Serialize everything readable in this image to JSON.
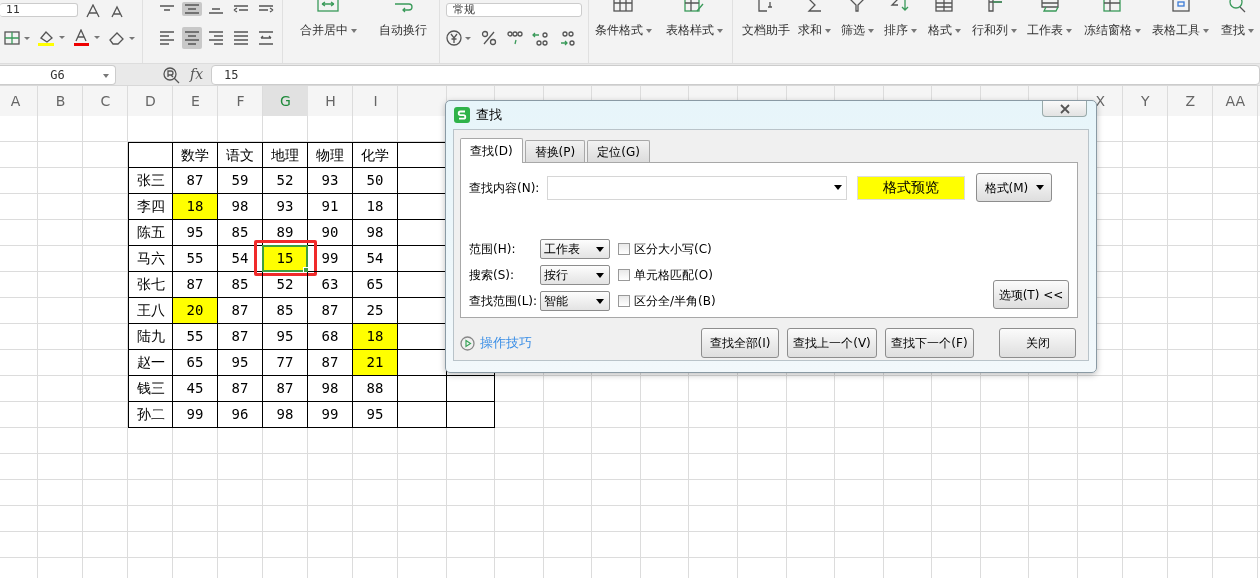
{
  "ribbon": {
    "font_size": "11",
    "number_format": "常规",
    "vertical_align": [
      {
        "selected": false
      },
      {
        "selected": true
      },
      {
        "selected": false
      },
      {
        "selected": false
      },
      {
        "selected": false
      }
    ],
    "horizontal_align": [
      {
        "selected": false
      },
      {
        "selected": true
      },
      {
        "selected": false
      },
      {
        "selected": false
      },
      {
        "selected": false
      }
    ],
    "merge": "合并居中",
    "wrap": "自动换行",
    "buttons": [
      {
        "label": "条件格式"
      },
      {
        "label": "表格样式"
      },
      {
        "label": "文档助手"
      },
      {
        "label": "求和"
      },
      {
        "label": "筛选"
      },
      {
        "label": "排序"
      },
      {
        "label": "格式"
      },
      {
        "label": "行和列"
      },
      {
        "label": "工作表"
      },
      {
        "label": "冻结窗格"
      },
      {
        "label": "表格工具"
      },
      {
        "label": "查找"
      }
    ]
  },
  "formula_bar": {
    "cell_ref": "G6",
    "fx": "fx",
    "value": "15"
  },
  "sheet": {
    "columns_left": [
      {
        "label": "A",
        "selected": false
      },
      {
        "label": "B",
        "selected": false
      },
      {
        "label": "C",
        "selected": false
      },
      {
        "label": "D",
        "selected": false
      },
      {
        "label": "E",
        "selected": false
      },
      {
        "label": "F",
        "selected": false
      },
      {
        "label": "G",
        "selected": true
      },
      {
        "label": "H",
        "selected": false
      },
      {
        "label": "I",
        "selected": false
      }
    ],
    "columns_right": [
      {
        "label": "X",
        "selected": false
      },
      {
        "label": "Y",
        "selected": false
      },
      {
        "label": "Z",
        "selected": false
      },
      {
        "label": "AA",
        "selected": false
      }
    ],
    "annotated_selection": true,
    "table_header": [
      "数学",
      "语文",
      "地理",
      "物理",
      "化学"
    ],
    "rows": [
      {
        "name": "张三",
        "cells": [
          {
            "text": "87",
            "highlighted": false,
            "selected": false
          },
          {
            "text": "59",
            "highlighted": false,
            "selected": false
          },
          {
            "text": "52",
            "highlighted": false,
            "selected": false
          },
          {
            "text": "93",
            "highlighted": false,
            "selected": false
          },
          {
            "text": "50",
            "highlighted": false,
            "selected": false
          }
        ]
      },
      {
        "name": "李四",
        "cells": [
          {
            "text": "18",
            "highlighted": true,
            "selected": false
          },
          {
            "text": "98",
            "highlighted": false,
            "selected": false
          },
          {
            "text": "93",
            "highlighted": false,
            "selected": false
          },
          {
            "text": "91",
            "highlighted": false,
            "selected": false
          },
          {
            "text": "18",
            "highlighted": false,
            "selected": false
          }
        ]
      },
      {
        "name": "陈五",
        "cells": [
          {
            "text": "95",
            "highlighted": false,
            "selected": false
          },
          {
            "text": "85",
            "highlighted": false,
            "selected": false
          },
          {
            "text": "89",
            "highlighted": false,
            "selected": false
          },
          {
            "text": "90",
            "highlighted": false,
            "selected": false
          },
          {
            "text": "98",
            "highlighted": false,
            "selected": false
          }
        ]
      },
      {
        "name": "马六",
        "cells": [
          {
            "text": "55",
            "highlighted": false,
            "selected": false
          },
          {
            "text": "54",
            "highlighted": false,
            "selected": false
          },
          {
            "text": "15",
            "highlighted": true,
            "selected": true
          },
          {
            "text": "99",
            "highlighted": false,
            "selected": false
          },
          {
            "text": "54",
            "highlighted": false,
            "selected": false
          }
        ]
      },
      {
        "name": "张七",
        "cells": [
          {
            "text": "87",
            "highlighted": false,
            "selected": false
          },
          {
            "text": "85",
            "highlighted": false,
            "selected": false
          },
          {
            "text": "52",
            "highlighted": false,
            "selected": false
          },
          {
            "text": "63",
            "highlighted": false,
            "selected": false
          },
          {
            "text": "65",
            "highlighted": false,
            "selected": false
          }
        ]
      },
      {
        "name": "王八",
        "cells": [
          {
            "text": "20",
            "highlighted": true,
            "selected": false
          },
          {
            "text": "87",
            "highlighted": false,
            "selected": false
          },
          {
            "text": "85",
            "highlighted": false,
            "selected": false
          },
          {
            "text": "87",
            "highlighted": false,
            "selected": false
          },
          {
            "text": "25",
            "highlighted": false,
            "selected": false
          }
        ]
      },
      {
        "name": "陆九",
        "cells": [
          {
            "text": "55",
            "highlighted": false,
            "selected": false
          },
          {
            "text": "87",
            "highlighted": false,
            "selected": false
          },
          {
            "text": "95",
            "highlighted": false,
            "selected": false
          },
          {
            "text": "68",
            "highlighted": false,
            "selected": false
          },
          {
            "text": "18",
            "highlighted": true,
            "selected": false
          }
        ]
      },
      {
        "name": "赵一",
        "cells": [
          {
            "text": "65",
            "highlighted": false,
            "selected": false
          },
          {
            "text": "95",
            "highlighted": false,
            "selected": false
          },
          {
            "text": "77",
            "highlighted": false,
            "selected": false
          },
          {
            "text": "87",
            "highlighted": false,
            "selected": false
          },
          {
            "text": "21",
            "highlighted": true,
            "selected": false
          }
        ]
      },
      {
        "name": "钱三",
        "cells": [
          {
            "text": "45",
            "highlighted": false,
            "selected": false
          },
          {
            "text": "87",
            "highlighted": false,
            "selected": false
          },
          {
            "text": "87",
            "highlighted": false,
            "selected": false
          },
          {
            "text": "98",
            "highlighted": false,
            "selected": false
          },
          {
            "text": "88",
            "highlighted": false,
            "selected": false
          }
        ]
      },
      {
        "name": "孙二",
        "cells": [
          {
            "text": "99",
            "highlighted": false,
            "selected": false
          },
          {
            "text": "96",
            "highlighted": false,
            "selected": false
          },
          {
            "text": "98",
            "highlighted": false,
            "selected": false
          },
          {
            "text": "99",
            "highlighted": false,
            "selected": false
          },
          {
            "text": "95",
            "highlighted": false,
            "selected": false
          }
        ]
      }
    ]
  },
  "dialog": {
    "title": "查找",
    "tabs": [
      {
        "label": "查找(D)",
        "selected": true
      },
      {
        "label": "替换(P)",
        "selected": false
      },
      {
        "label": "定位(G)",
        "selected": false
      }
    ],
    "find_label": "查找内容(N):",
    "format_preview": "格式预览",
    "format_button": "格式(M)",
    "options": [
      {
        "label": "范围(H):",
        "value": "工作表",
        "checkbox": "区分大小写(C)",
        "checked": false
      },
      {
        "label": "搜索(S):",
        "value": "按行",
        "checkbox": "单元格匹配(O)",
        "checked": false
      },
      {
        "label": "查找范围(L):",
        "value": "智能",
        "checkbox": "区分全/半角(B)",
        "checked": false
      }
    ],
    "options_button": "选项(T) <<",
    "tips_link": "操作技巧",
    "buttons": [
      "查找全部(I)",
      "查找上一个(V)",
      "查找下一个(F)"
    ],
    "close_button": "关闭"
  }
}
